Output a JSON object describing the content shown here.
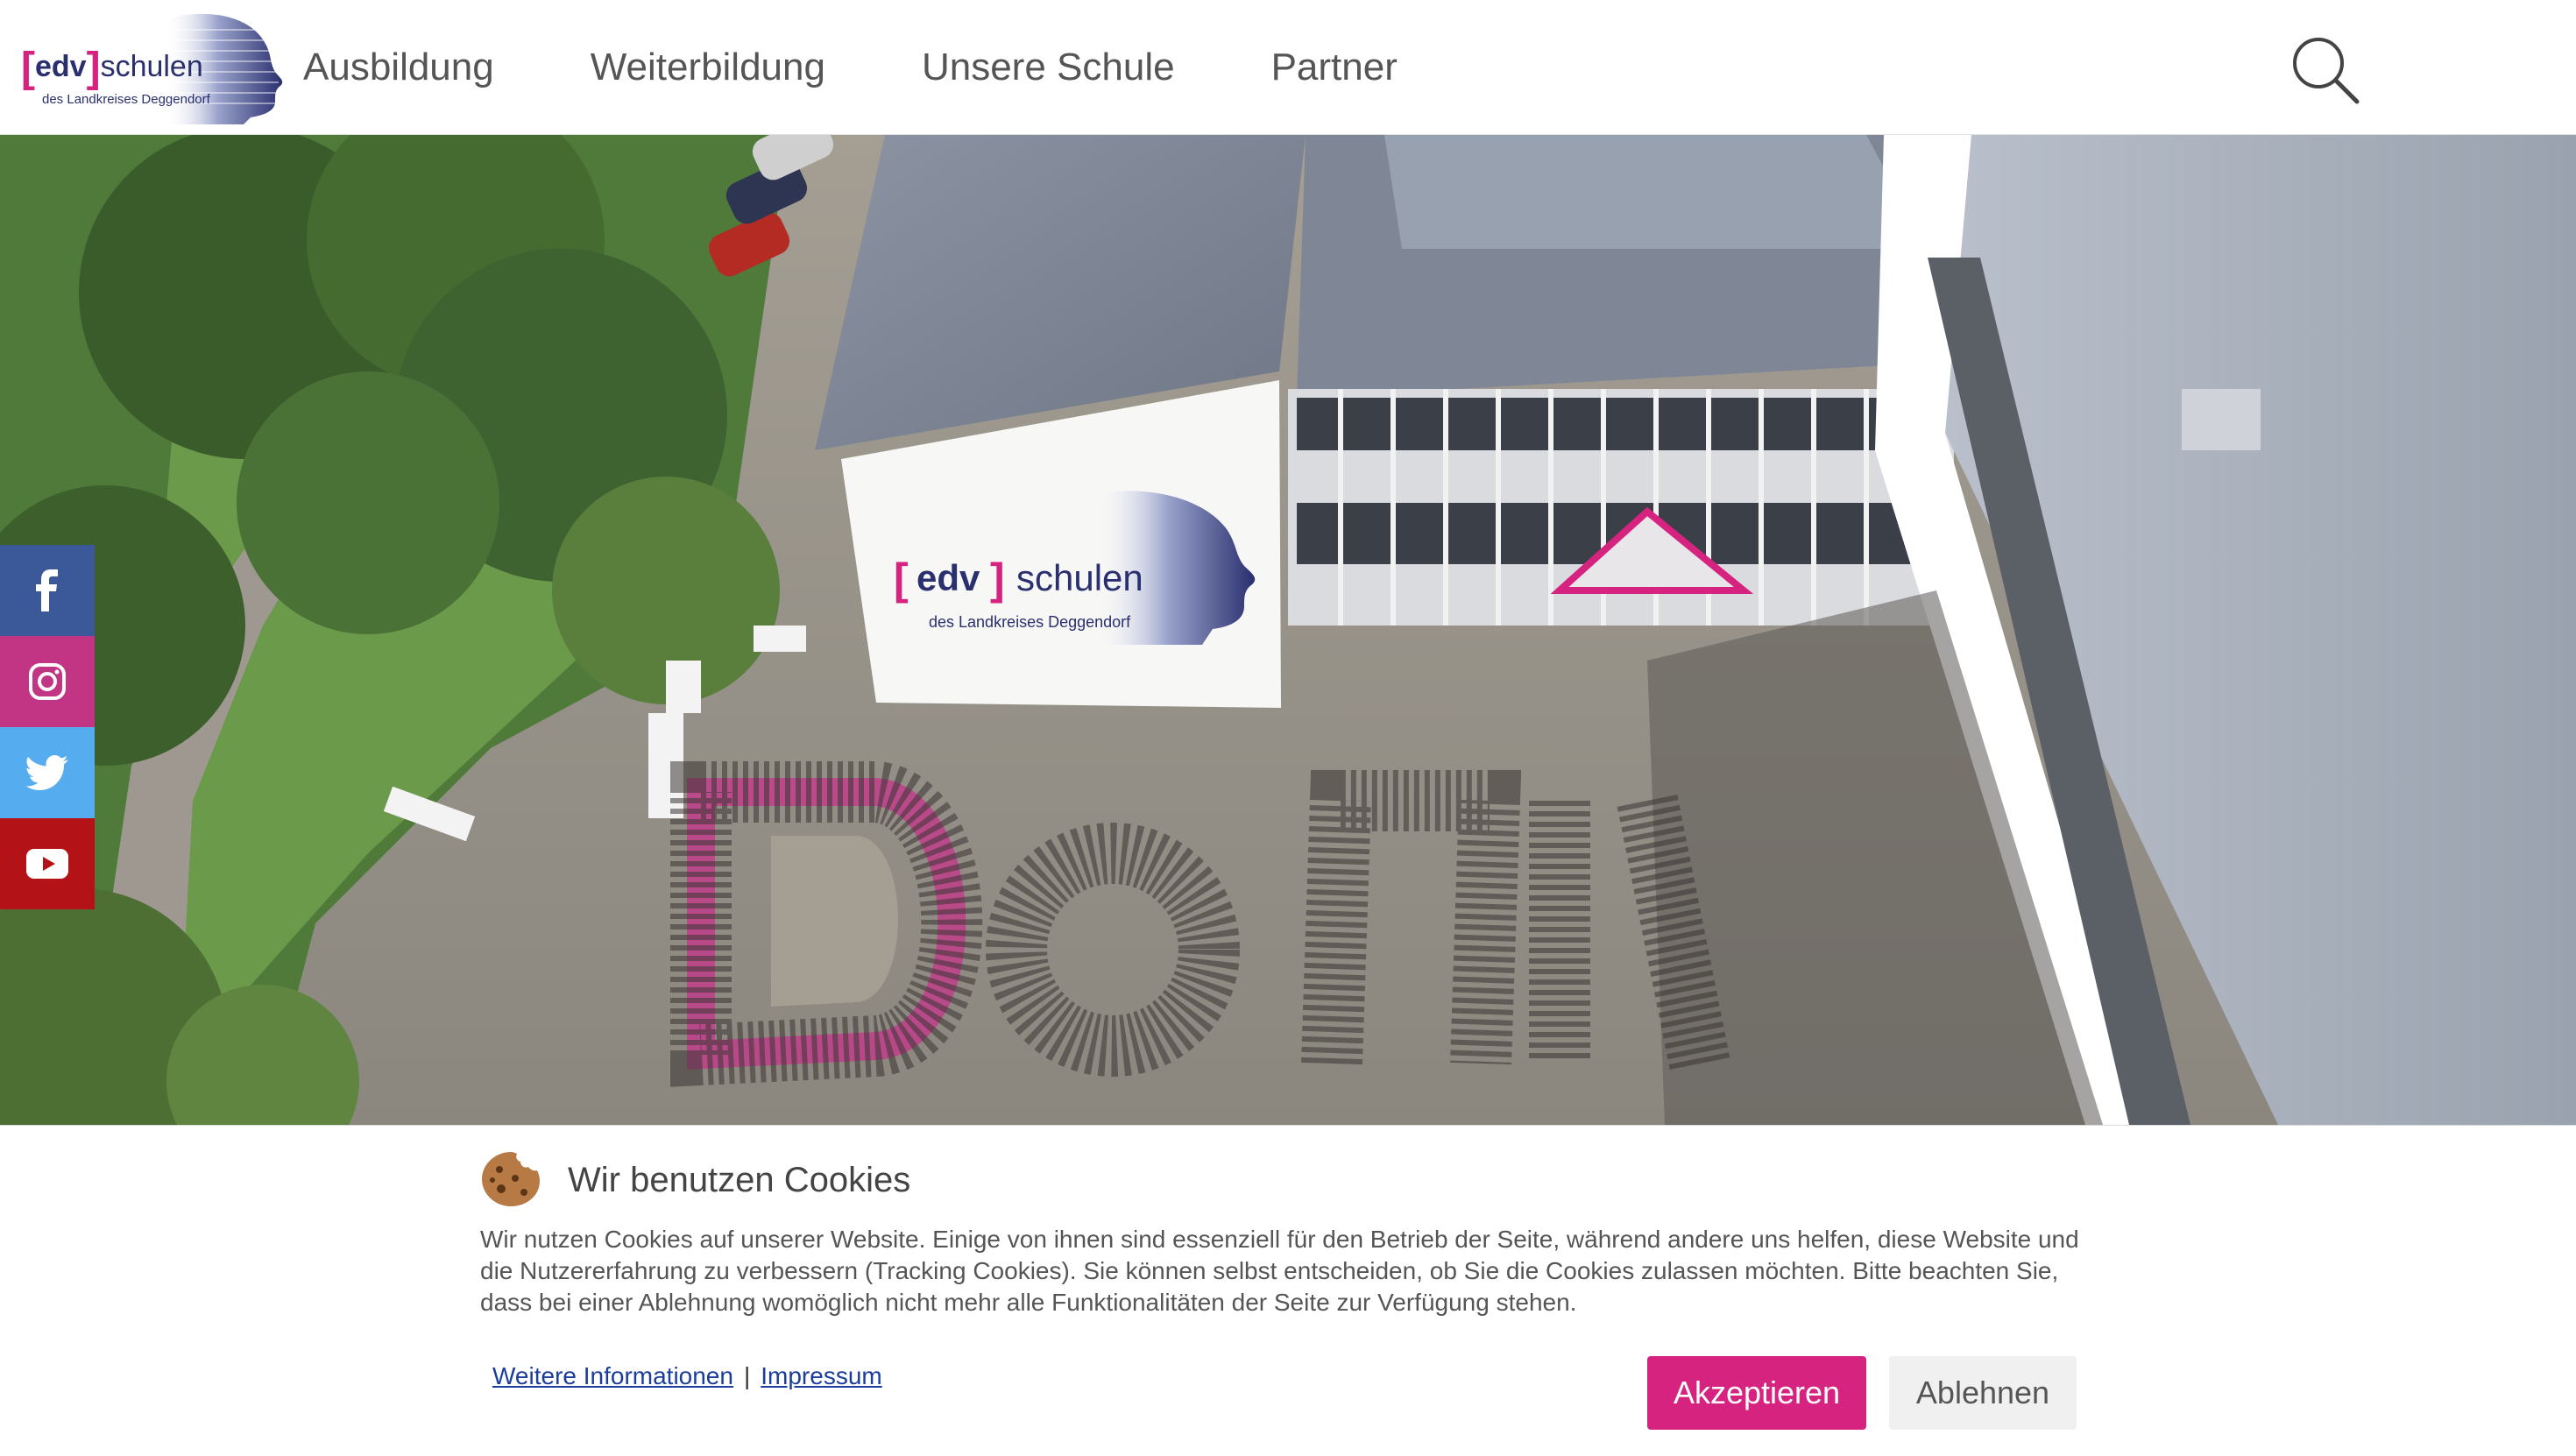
{
  "header": {
    "logo": {
      "bracket_open": "[",
      "brand_edv": "edv",
      "bracket_close": "]",
      "brand_schulen": "schulen",
      "subtitle": "des Landkreises Deggendorf"
    },
    "nav": [
      {
        "label": "Ausbildung"
      },
      {
        "label": "Weiterbildung"
      },
      {
        "label": "Unsere Schule"
      },
      {
        "label": "Partner"
      }
    ],
    "search_icon": "search-icon"
  },
  "hero": {
    "building_logo": {
      "bracket_open": "[",
      "brand_edv": "edv",
      "bracket_close": "]",
      "brand_schulen": "schulen",
      "subtitle": "des Landkreises Deggendorf"
    }
  },
  "social": [
    {
      "icon": "facebook-icon",
      "color": "#3b5998"
    },
    {
      "icon": "instagram-icon",
      "color": "#c13584"
    },
    {
      "icon": "twitter-icon",
      "color": "#55acee"
    },
    {
      "icon": "youtube-icon",
      "color": "#b31217"
    }
  ],
  "cookie_banner": {
    "icon": "cookie-icon",
    "title": "Wir benutzen Cookies",
    "text": "Wir nutzen Cookies auf unserer Website. Einige von ihnen sind essenziell für den Betrieb der Seite, während andere uns helfen, diese Website und die Nutzererfahrung zu verbessern (Tracking Cookies). Sie können selbst entscheiden, ob Sie die Cookies zulassen möchten. Bitte beachten Sie, dass bei einer Ablehnung womöglich nicht mehr alle Funktionalitäten der Seite zur Verfügung stehen.",
    "more_info_link": "Weitere Informationen",
    "separator": "|",
    "imprint_link": "Impressum",
    "accept_label": "Akzeptieren",
    "reject_label": "Ablehnen"
  },
  "colors": {
    "brand_pink": "#d6237f",
    "brand_navy": "#2a2f6e",
    "link_blue": "#1b3d9c"
  }
}
